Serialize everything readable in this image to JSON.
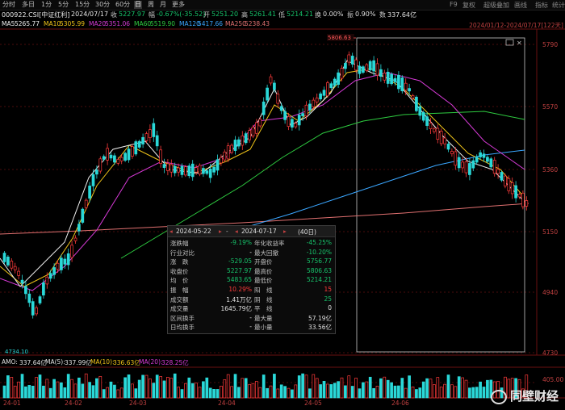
{
  "toolbar": {
    "tabs": [
      {
        "label": "分时"
      },
      {
        "label": "多日"
      },
      {
        "label": "1分"
      },
      {
        "label": "5分"
      },
      {
        "label": "15分"
      },
      {
        "label": "30分"
      },
      {
        "label": "60分"
      },
      {
        "label": "日"
      },
      {
        "label": "周"
      },
      {
        "label": "月"
      },
      {
        "label": "更多"
      }
    ],
    "right": [
      "F9",
      "复权",
      "超级叠加",
      "画线",
      "指标",
      "统计"
    ]
  },
  "quote": {
    "code": "000922.CSI[中证红利]",
    "date": "2024/07/17",
    "close_label": "收",
    "close": "5227.97",
    "change_label": "幅",
    "change": "-0.67%(-35.52)",
    "open_label": "开",
    "open": "5251.20",
    "high_label": "高",
    "high": "5261.41",
    "low_label": "低",
    "low": "5214.21",
    "turnover_label": "换",
    "turnover": "0.00%",
    "amplitude_label": "振",
    "amplitude": "0.90%",
    "volume_label": "数",
    "volume": "337.64亿"
  },
  "ma": [
    {
      "name": "MA5",
      "value": "5265.77",
      "color": "#f0f0f0"
    },
    {
      "name": "MA10",
      "value": "5305.99",
      "color": "#f0c419"
    },
    {
      "name": "MA20",
      "value": "5351.06",
      "color": "#d63ad6"
    },
    {
      "name": "MA60",
      "value": "5519.90",
      "color": "#2ecc40"
    },
    {
      "name": "MA120",
      "value": "5417.66",
      "color": "#3aa6ff"
    },
    {
      "name": "MA250",
      "value": "5238.43",
      "color": "#e07070"
    }
  ],
  "range_label": "2024/01/12-2024/07/17[122天]",
  "price_axis": [
    "5790",
    "5570",
    "5360",
    "5150",
    "4940",
    "4730"
  ],
  "annotations": {
    "high": "5806.63",
    "low": "4734.10"
  },
  "date_axis": [
    "24-01",
    "24-02",
    "24-03",
    "24-04",
    "24-05",
    "24-06"
  ],
  "popup": {
    "start": "2024-05-22",
    "end": "2024-07-17",
    "days": "(40日)",
    "rows": [
      {
        "l1": "涨跌幅",
        "v1": "-9.19%",
        "c1": "grn",
        "l2": "年化收益率",
        "v2": "-45.25%",
        "c2": "grn"
      },
      {
        "l1": "行业对比",
        "v1": "-",
        "c1": "wht",
        "l2": "最大回撤",
        "v2": "-10.20%",
        "c2": "grn"
      },
      {
        "l1": "涨　跌",
        "v1": "-529.05",
        "c1": "grn",
        "l2": "开盘价",
        "v2": "5756.77",
        "c2": "grn"
      },
      {
        "l1": "收盘价",
        "v1": "5227.97",
        "c1": "grn",
        "l2": "最高价",
        "v2": "5806.63",
        "c2": "grn"
      },
      {
        "l1": "均　价",
        "v1": "5483.65",
        "c1": "grn",
        "l2": "最低价",
        "v2": "5214.21",
        "c2": "grn"
      },
      {
        "l1": "振　幅",
        "v1": "10.29%",
        "c1": "red",
        "l2": "阳　线",
        "v2": "15",
        "c2": "red"
      },
      {
        "l1": "成交额",
        "v1": "1.41万亿",
        "c1": "wht",
        "l2": "阴　线",
        "v2": "25",
        "c2": "grn"
      },
      {
        "l1": "成交量",
        "v1": "1645.79亿",
        "c1": "wht",
        "l2": "平　线",
        "v2": "0",
        "c2": "wht"
      },
      {
        "l1": "区间换手",
        "v1": "-",
        "c1": "wht",
        "l2": "最大量",
        "v2": "57.19亿",
        "c2": "wht"
      },
      {
        "l1": "日均换手",
        "v1": "-",
        "c1": "wht",
        "l2": "最小量",
        "v2": "33.56亿",
        "c2": "wht"
      }
    ]
  },
  "amo": [
    {
      "name": "AMO:",
      "value": "337.64亿",
      "color": "#e0e0e0"
    },
    {
      "name": "MA(5):",
      "value": "337.99亿",
      "color": "#e0e0e0"
    },
    {
      "name": "MA(10):",
      "value": "336.63亿",
      "color": "#f0c419"
    },
    {
      "name": "MA(20):",
      "value": "328.25亿",
      "color": "#d63ad6"
    }
  ],
  "volume_axis": "405.00",
  "watermark": "同壁财经",
  "colors": {
    "up": "#ff3b3b",
    "down": "#2ad8d8",
    "grid": "#5a1010"
  }
}
